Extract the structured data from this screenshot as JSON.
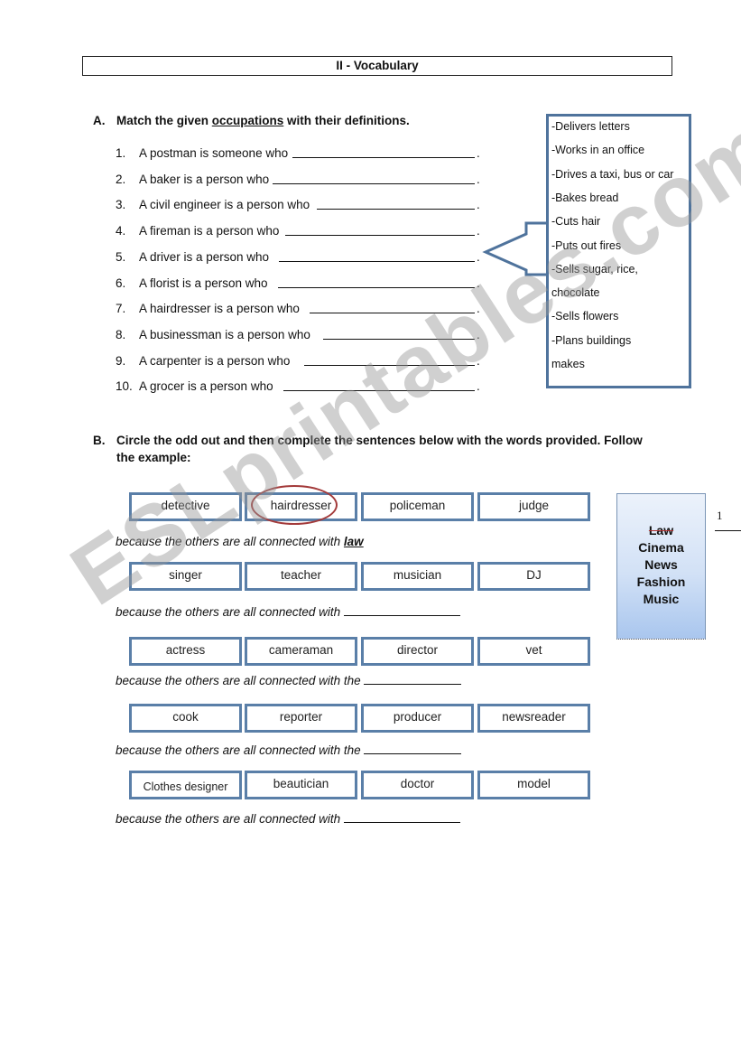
{
  "document": {
    "title": "II - Vocabulary"
  },
  "section_a": {
    "letter": "A.",
    "instruction_pre": "Match the given ",
    "instruction_underlined": "occupations",
    "instruction_post": " with their definitions.",
    "questions": [
      {
        "num": "1.",
        "text": "A postman is someone who"
      },
      {
        "num": "2.",
        "text": "A baker is a person who"
      },
      {
        "num": "3.",
        "text": "A civil engineer is a person who"
      },
      {
        "num": "4.",
        "text": "A fireman is a person who"
      },
      {
        "num": "5.",
        "text": "A driver is a person who"
      },
      {
        "num": "6.",
        "text": "A florist is a person who"
      },
      {
        "num": "7.",
        "text": "A hairdresser is a person who"
      },
      {
        "num": "8.",
        "text": "A businessman is a person who"
      },
      {
        "num": "9.",
        "text": "A carpenter is a person who"
      },
      {
        "num": "10.",
        "text": "A grocer is a person who"
      }
    ],
    "line_end": ".",
    "definitions": [
      "-Delivers letters",
      "-Works in an office",
      "-Drives a taxi, bus or car",
      "-Bakes bread",
      "-Cuts hair",
      "-Puts out fires",
      "-Sells sugar, rice,",
      "chocolate",
      "-Sells flowers",
      "-Plans buildings",
      "makes"
    ]
  },
  "section_b": {
    "letter": "B.",
    "instruction_line1": "Circle the odd out and then complete the sentences below with the words provided. Follow",
    "instruction_line2": "the example:",
    "groups": [
      {
        "words": [
          "detective",
          "hairdresser",
          "policeman",
          "judge"
        ],
        "circled": 1,
        "sentence": "because the others are all connected with ",
        "answer": "law"
      },
      {
        "words": [
          "singer",
          "teacher",
          "musician",
          "DJ"
        ],
        "sentence": "because the others are all connected with ",
        "answer": ""
      },
      {
        "words": [
          "actress",
          "cameraman",
          "director",
          "vet"
        ],
        "sentence": "because the others are all connected with the ",
        "answer": ""
      },
      {
        "words": [
          "cook",
          "reporter",
          "producer",
          "newsreader"
        ],
        "sentence": "because the others are all connected with the ",
        "answer": ""
      },
      {
        "words": [
          "Clothes designer",
          "beautician",
          "doctor",
          "model"
        ],
        "sentence": "because the others are all connected with ",
        "answer": ""
      }
    ],
    "word_bank": [
      {
        "word": "Law",
        "struck": true
      },
      {
        "word": "Cinema",
        "struck": false
      },
      {
        "word": "News",
        "struck": false
      },
      {
        "word": "Fashion",
        "struck": false
      },
      {
        "word": "Music",
        "struck": false
      }
    ],
    "colors": {
      "box_border": "#5a7fa8",
      "circle": "#a33a3a",
      "bank_gradient_bottom": "#a9c6ee"
    }
  },
  "page_mark": "1",
  "watermark": "ESLprintables.com"
}
